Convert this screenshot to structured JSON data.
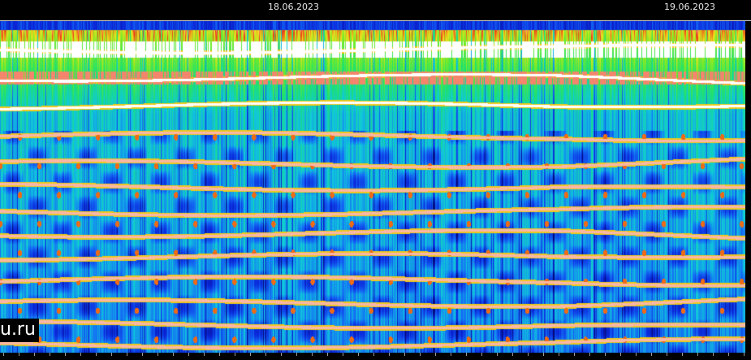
{
  "dates": [
    "18.06.2023",
    "19.06.2023"
  ],
  "watermark": "u.ru",
  "colors": {
    "background": "#000000",
    "deep_blue": "#0a1fd0",
    "mid_blue": "#1a6af0",
    "cyan": "#10c8d8",
    "green": "#20e060",
    "yellow": "#f0e020",
    "red": "#e02010",
    "white": "#ffffff"
  }
}
